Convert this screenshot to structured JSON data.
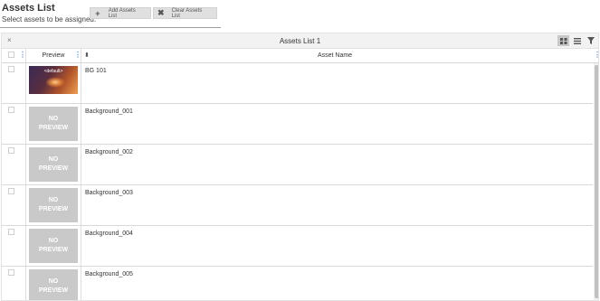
{
  "header": {
    "title": "Assets List",
    "subtitle": "Select assets to be assigned.",
    "add_button": {
      "icon": "plus-icon",
      "label": "Add Assets List"
    },
    "clear_button": {
      "icon": "close-icon",
      "label": "Clear Assets List"
    }
  },
  "grid": {
    "title": "Assets List 1",
    "close_icon": "×",
    "view_buttons": [
      "grid-view-icon",
      "list-view-icon",
      "filter-icon"
    ],
    "columns": {
      "preview": "Preview",
      "name": "Asset Name"
    },
    "no_preview_text": "NO PREVIEW",
    "rows": [
      {
        "name": "BG 101",
        "preview": "thumbnail",
        "thumb_label": "<default>"
      },
      {
        "name": "Background_001",
        "preview": "none"
      },
      {
        "name": "Background_002",
        "preview": "none"
      },
      {
        "name": "Background_003",
        "preview": "none"
      },
      {
        "name": "Background_004",
        "preview": "none"
      },
      {
        "name": "Background_005",
        "preview": "none"
      }
    ]
  }
}
